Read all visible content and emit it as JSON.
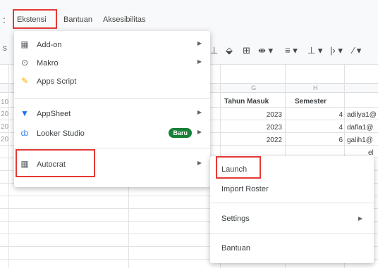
{
  "menubar": {
    "edge": ":",
    "items": [
      "Ekstensi",
      "Bantuan",
      "Aksesibilitas"
    ]
  },
  "toolbar": {
    "left": "s",
    "icons": [
      "text-color-icon",
      "fill-color-icon",
      "borders-icon",
      "merge-cells-icon",
      "align-icon",
      "valign-icon",
      "wrap-icon"
    ]
  },
  "sheet": {
    "columns": [
      "G",
      "H"
    ],
    "headers": [
      "Tahun Masuk",
      "Semester"
    ],
    "rows": [
      {
        "row": "10",
        "tahun": "2023",
        "semester": "4",
        "email": "adilya1@"
      },
      {
        "row": "20",
        "tahun": "2023",
        "semester": "4",
        "email": "dafla1@"
      },
      {
        "row": "20",
        "tahun": "2022",
        "semester": "6",
        "email": "galih1@"
      },
      {
        "row": "20",
        "tahun": "",
        "semester": "",
        "email": "el"
      }
    ]
  },
  "ekstensi_menu": {
    "items": [
      {
        "icon": "add-on-icon",
        "label": "Add-on",
        "has_submenu": true
      },
      {
        "icon": "macro-icon",
        "label": "Makro",
        "has_submenu": true
      },
      {
        "icon": "apps-script-icon",
        "label": "Apps Script",
        "has_submenu": false
      },
      {
        "icon": "appsheet-icon",
        "label": "AppSheet",
        "has_submenu": true
      },
      {
        "icon": "looker-studio-icon",
        "label": "Looker Studio",
        "has_submenu": true,
        "badge": "Baru"
      },
      {
        "icon": "autocrat-icon",
        "label": "Autocrat",
        "has_submenu": true
      }
    ]
  },
  "autocrat_submenu": {
    "items": [
      {
        "label": "Launch"
      },
      {
        "label": "Import Roster"
      },
      {
        "label": "Settings",
        "has_submenu": true
      },
      {
        "label": "Bantuan"
      }
    ]
  },
  "colors": {
    "highlight": "#e53935",
    "badge": "#188038",
    "appsheet": "#1a73e8",
    "apps_script": "#f9ab00"
  }
}
